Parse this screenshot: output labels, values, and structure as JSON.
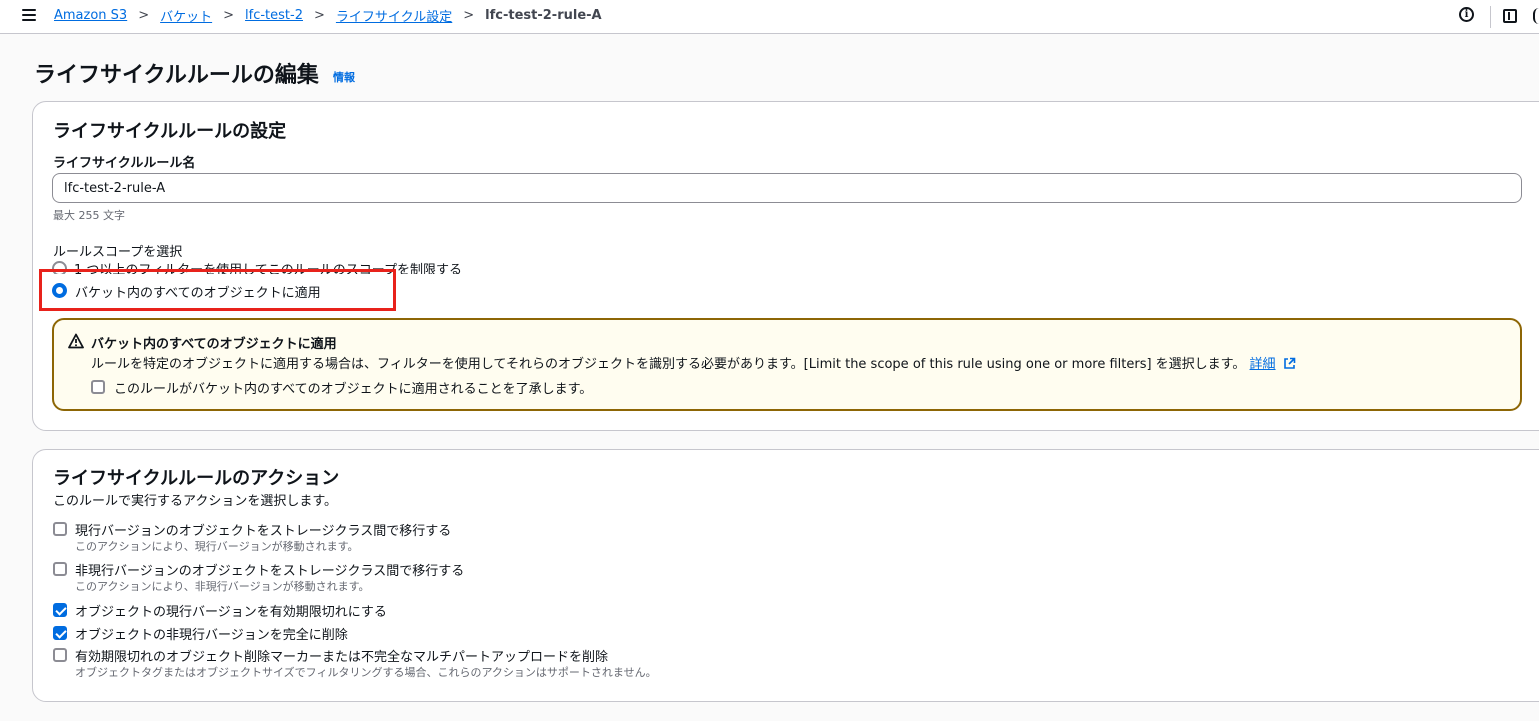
{
  "breadcrumb": {
    "items": [
      "Amazon S3",
      "バケット",
      "lfc-test-2",
      "ライフサイクル設定"
    ],
    "current": "lfc-test-2-rule-A",
    "separator": ">"
  },
  "header": {
    "title": "ライフサイクルルールの編集",
    "info_link": "情報"
  },
  "config": {
    "title": "ライフサイクルルールの設定",
    "name_label": "ライフサイクルルール名",
    "name_value": "lfc-test-2-rule-A",
    "name_hint": "最大 255 文字",
    "scope_label": "ルールスコープを選択",
    "scope_options": [
      {
        "label": "1 つ以上のフィルターを使用してこのルールのスコープを制限する",
        "selected": false
      },
      {
        "label": "バケット内のすべてのオブジェクトに適用",
        "selected": true
      }
    ],
    "alert": {
      "title": "バケット内のすべてのオブジェクトに適用",
      "body": "ルールを特定のオブジェクトに適用する場合は、フィルターを使用してそれらのオブジェクトを識別する必要があります。[Limit the scope of this rule using one or more filters] を選択します。",
      "link": "詳細",
      "ack_label": "このルールがバケット内のすべてのオブジェクトに適用されることを了承します。",
      "ack_checked": false
    }
  },
  "actions": {
    "title": "ライフサイクルルールのアクション",
    "subtitle": "このルールで実行するアクションを選択します。",
    "items": [
      {
        "label": "現行バージョンのオブジェクトをストレージクラス間で移行する",
        "desc": "このアクションにより、現行バージョンが移動されます。",
        "checked": false
      },
      {
        "label": "非現行バージョンのオブジェクトをストレージクラス間で移行する",
        "desc": "このアクションにより、非現行バージョンが移動されます。",
        "checked": false
      },
      {
        "label": "オブジェクトの現行バージョンを有効期限切れにする",
        "desc": "",
        "checked": true
      },
      {
        "label": "オブジェクトの非現行バージョンを完全に削除",
        "desc": "",
        "checked": true
      },
      {
        "label": "有効期限切れのオブジェクト削除マーカーまたは不完全なマルチパートアップロードを削除",
        "desc": "オブジェクトタグまたはオブジェクトサイズでフィルタリングする場合、これらのアクションはサポートされません。",
        "checked": false
      }
    ]
  },
  "colors": {
    "link": "#006ce0",
    "highlight": "#e8221b",
    "warning_border": "#8d6605",
    "warning_bg": "#fffdf0"
  }
}
